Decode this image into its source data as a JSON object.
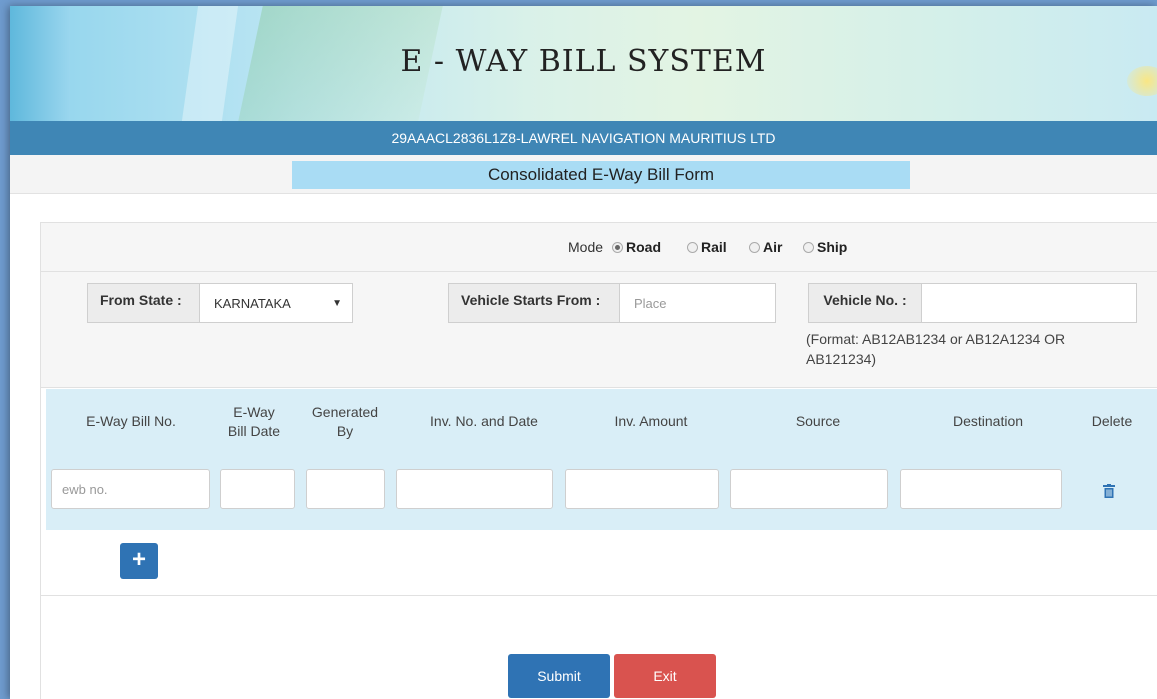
{
  "header": {
    "title": "E - WAY BILL SYSTEM",
    "gstin_name": "29AAACL2836L1Z8-LAWREL NAVIGATION MAURITIUS LTD",
    "form_title": "Consolidated E-Way Bill Form"
  },
  "mode": {
    "label": "Mode",
    "options": [
      "Road",
      "Rail",
      "Air",
      "Ship"
    ],
    "selected": "Road"
  },
  "state_row": {
    "from_state_label": "From State :",
    "from_state_value": "KARNATAKA",
    "vehicle_starts_label": "Vehicle Starts From :",
    "vehicle_starts_placeholder": "Place",
    "vehicle_no_label": "Vehicle No. :",
    "vehicle_no_value": "",
    "vehicle_no_hint": "(Format: AB12AB1234 or AB12A1234 OR AB121234)"
  },
  "table": {
    "headers": [
      "E-Way Bill No.",
      "E-Way Bill Date",
      "Generated By",
      "Inv. No. and Date",
      "Inv. Amount",
      "Source",
      "Destination",
      "Delete"
    ],
    "row": {
      "ewb_placeholder": "ewb no.",
      "ewb_date": "",
      "generated_by": "",
      "inv_no_date": "",
      "inv_amount": "",
      "source": "",
      "destination": ""
    },
    "add_label": "+"
  },
  "actions": {
    "submit_label": "Submit",
    "exit_label": "Exit"
  },
  "icons": {
    "delete": "trash-icon",
    "add": "plus-icon",
    "dropdown": "caret-down-icon"
  },
  "colors": {
    "primary": "#2f73b4",
    "danger": "#d9534f",
    "header_bar": "#3f86b5",
    "form_title_bg": "#a9dcf4",
    "grid_bg": "#d9eef7"
  }
}
